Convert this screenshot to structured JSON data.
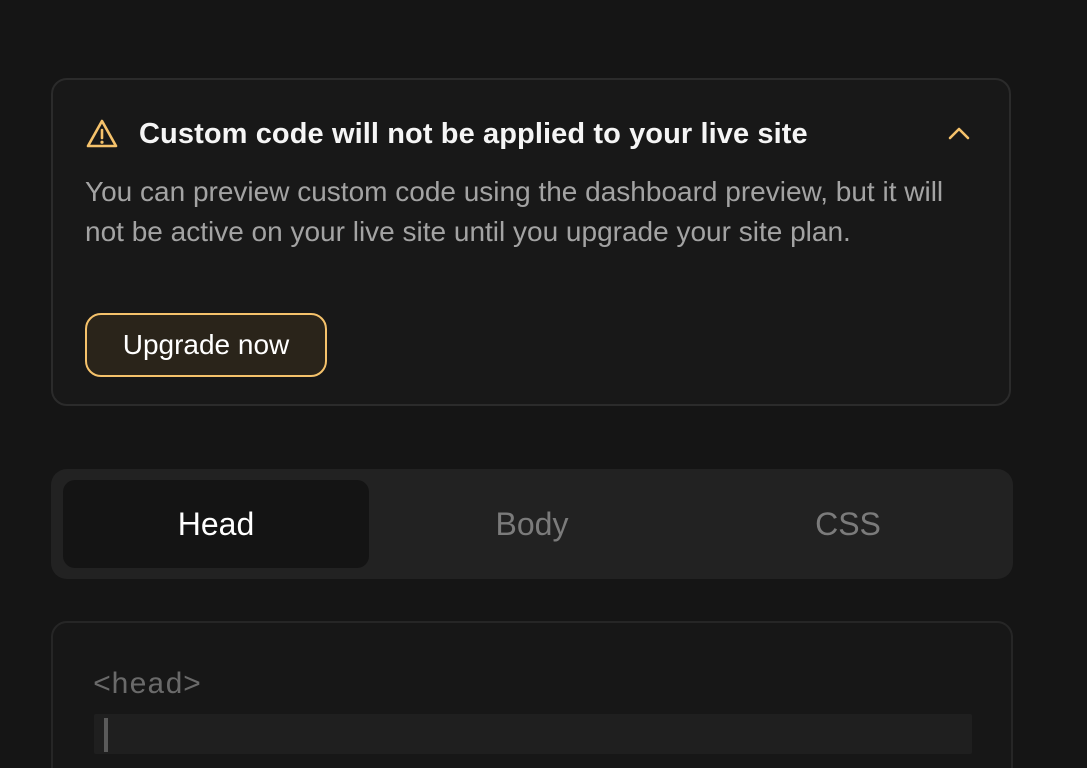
{
  "callout": {
    "icon": "warning-triangle-icon",
    "title": "Custom code will not be applied to your live site",
    "body": "You can preview custom code using the dashboard preview, but it will not be active on your live site until you upgrade your site plan.",
    "button_label": "Upgrade now",
    "collapse_icon": "chevron-up-icon",
    "accent_color": "#f5c26b"
  },
  "tabs": {
    "items": [
      {
        "label": "Head",
        "active": true
      },
      {
        "label": "Body",
        "active": false
      },
      {
        "label": "CSS",
        "active": false
      }
    ]
  },
  "editor": {
    "opening_tag": "<head>",
    "value": ""
  }
}
